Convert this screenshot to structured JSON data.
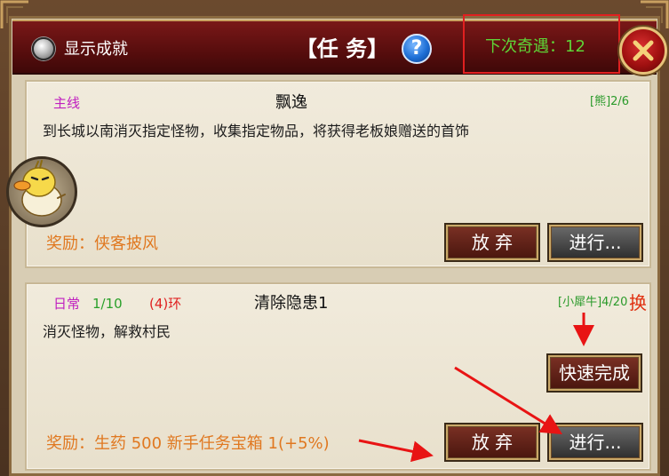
{
  "header": {
    "show_achievements_label": "显示成就",
    "title": "【任  务】",
    "help_label": "?",
    "next_encounter": "下次奇遇：12"
  },
  "quests": [
    {
      "category": "主线",
      "name": "飘逸",
      "target": "[熊]2/6",
      "description": "到长城以南消灭指定怪物，收集指定物品，将获得老板娘赠送的首饰",
      "reward": "奖励：侠客披风",
      "abandon_label": "放 弃",
      "go_label": "进行..."
    },
    {
      "category": "日常",
      "progress": "1/10",
      "ring": "(4)环",
      "name": "清除隐患1",
      "target": "[小犀牛]4/20",
      "swap_label": "换",
      "description": "消灭怪物，解救村民",
      "quick_complete_label": "快速完成",
      "reward": "奖励：生药 500 新手任务宝箱 1(+5%)",
      "abandon_label": "放 弃",
      "go_label": "进行..."
    }
  ],
  "colors": {
    "title_bar": "#6a1212",
    "main_category": "#c020c0",
    "progress_green": "#2aa02a",
    "ring_red": "#e02020",
    "reward_orange": "#e07820",
    "highlight_red": "#e02020"
  },
  "icons": {
    "close": "close-icon",
    "help": "question-icon",
    "avatar": "duck-mascot-icon",
    "annotation": "red-arrow-icon"
  }
}
